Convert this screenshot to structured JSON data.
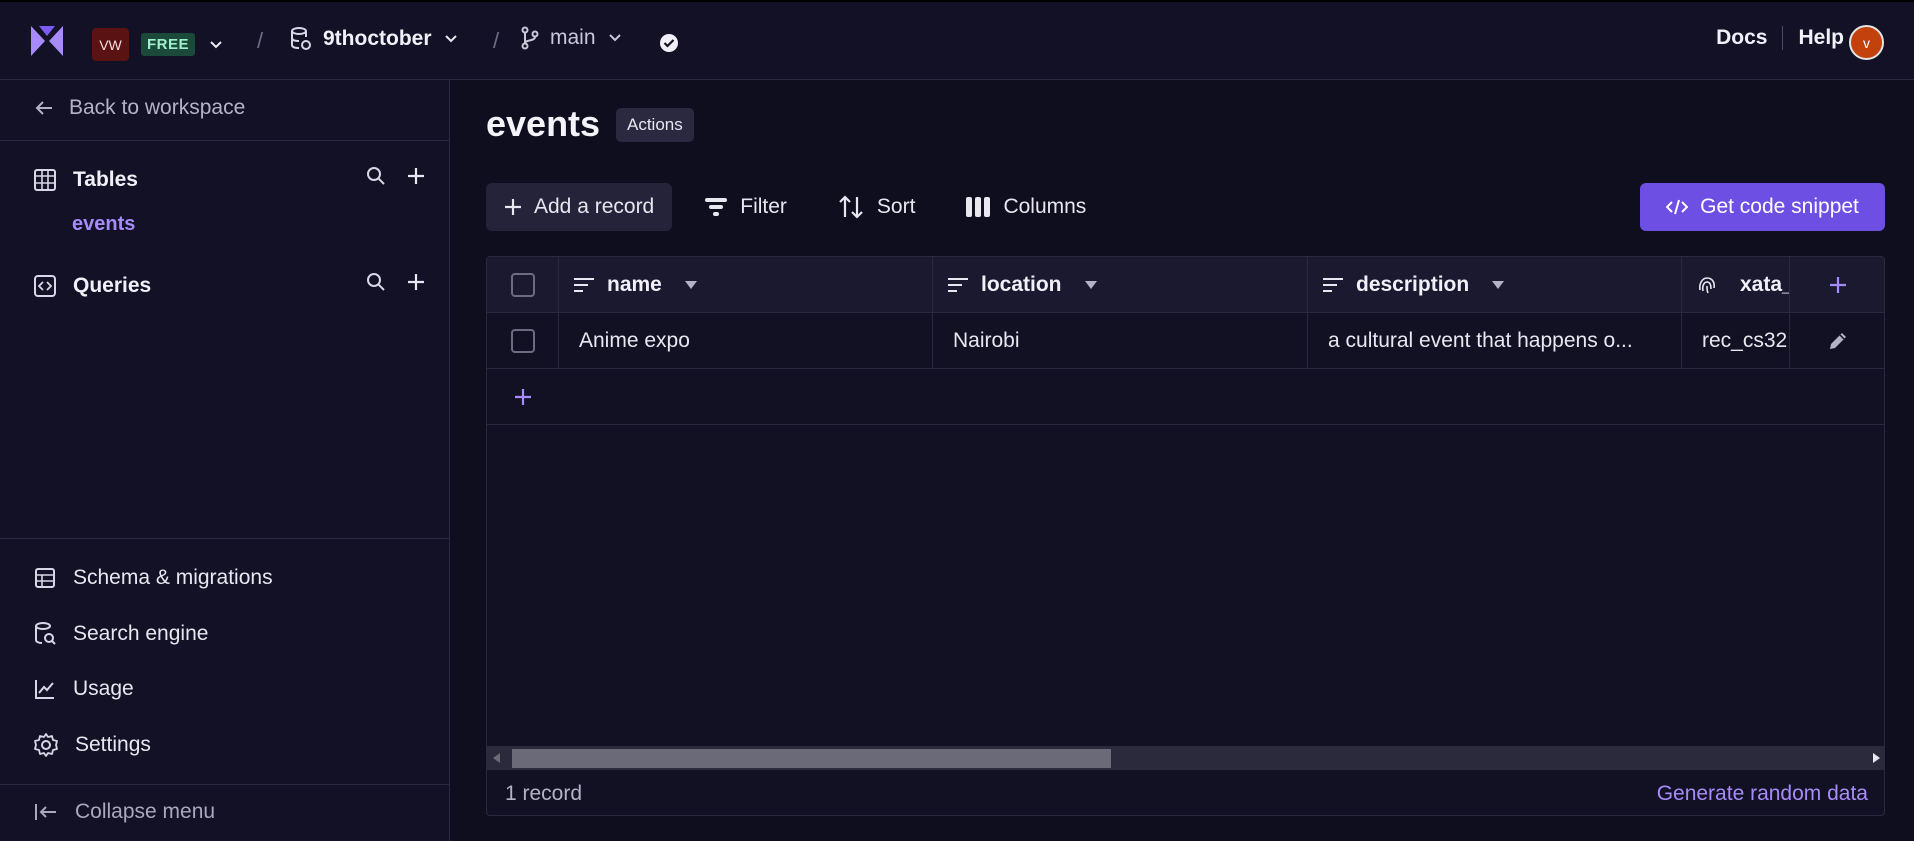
{
  "topbar": {
    "workspace_initials": "VW",
    "plan_badge": "FREE",
    "database_name": "9thoctober",
    "branch_name": "main",
    "docs_label": "Docs",
    "help_label": "Help",
    "user_initial": "v"
  },
  "sidebar": {
    "back_label": "Back to workspace",
    "tables_label": "Tables",
    "tables": [
      "events"
    ],
    "queries_label": "Queries",
    "bottom_items": [
      {
        "label": "Schema & migrations",
        "icon": "schema-icon"
      },
      {
        "label": "Search engine",
        "icon": "search-engine-icon"
      },
      {
        "label": "Usage",
        "icon": "usage-chart-icon"
      },
      {
        "label": "Settings",
        "icon": "settings-gear-icon"
      }
    ],
    "collapse_label": "Collapse menu"
  },
  "main": {
    "table_title": "events",
    "actions_label": "Actions",
    "toolbar": {
      "add_record": "Add a record",
      "filter": "Filter",
      "sort": "Sort",
      "columns": "Columns",
      "snippet": "Get code snippet"
    },
    "grid": {
      "columns": [
        "name",
        "location",
        "description",
        "xata_"
      ],
      "rows": [
        {
          "name": "Anime expo",
          "location": "Nairobi",
          "description": "a cultural event that happens o...",
          "xata_id": "rec_cs32"
        }
      ],
      "footer_count": "1 record",
      "generate_label": "Generate random data"
    }
  },
  "colors": {
    "accent": "#a78bfa",
    "primary_button": "#6d4fe3",
    "background": "#0f0e1f"
  }
}
